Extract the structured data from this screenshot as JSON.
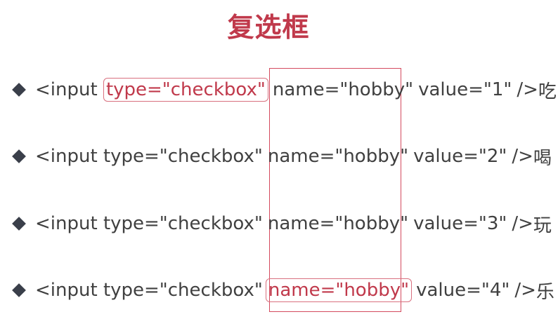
{
  "slide": {
    "title": "复选框"
  },
  "lines": [
    {
      "pre": "<input ",
      "type_attr": "type=\"checkbox\"",
      "name_attr": "name=\"hobby\"",
      "value_attr": "value=\"1\"",
      "close": "/>",
      "label": "吃"
    },
    {
      "pre": "<input ",
      "type_attr": "type=\"checkbox\"",
      "name_attr": "name=\"hobby\"",
      "value_attr": "value=\"2\"",
      "close": "/>",
      "label": "喝"
    },
    {
      "pre": "<input ",
      "type_attr": "type=\"checkbox\"",
      "name_attr": "name=\"hobby\"",
      "value_attr": "value=\"3\"",
      "close": "/>",
      "label": "玩"
    },
    {
      "pre": "<input ",
      "type_attr": "type=\"checkbox\"",
      "name_attr": "name=\"hobby\"",
      "value_attr": "value=\"4\"",
      "close": "/>",
      "label": "乐"
    }
  ],
  "bullet_icon": "diamond-bullet-icon",
  "colors": {
    "accent": "#c0394b",
    "text": "#404040",
    "bullet": "#3a3f4a"
  }
}
